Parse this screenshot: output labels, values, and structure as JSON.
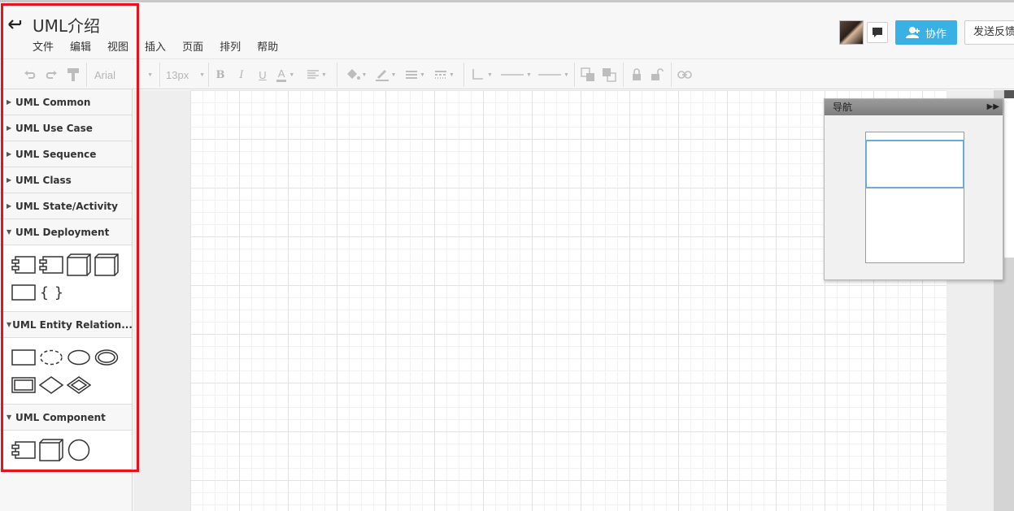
{
  "header": {
    "title": "UML介绍",
    "menu": [
      "文件",
      "编辑",
      "视图",
      "插入",
      "页面",
      "排列",
      "帮助"
    ],
    "collab_label": "协作",
    "feedback_label": "发送反馈"
  },
  "toolbar": {
    "font_family": "Arial",
    "font_size": "13px",
    "bold": "B",
    "italic": "I",
    "underline": "U",
    "font_color": "A"
  },
  "sidebar": {
    "categories": [
      {
        "label": "UML Common",
        "expanded": false
      },
      {
        "label": "UML Use Case",
        "expanded": false
      },
      {
        "label": "UML Sequence",
        "expanded": false
      },
      {
        "label": "UML Class",
        "expanded": false
      },
      {
        "label": "UML State/Activity",
        "expanded": false
      },
      {
        "label": "UML Deployment",
        "expanded": true,
        "shapes": [
          "component",
          "component",
          "node",
          "node",
          "rectangle",
          "braces"
        ]
      },
      {
        "label": "UML Entity Relation...",
        "expanded": true,
        "shapes": [
          "entity",
          "weak-attribute-dashed",
          "attribute-ellipse",
          "multivalued-attribute",
          "weak-entity",
          "relationship-diamond",
          "identifying-relationship"
        ]
      },
      {
        "label": "UML Component",
        "expanded": true,
        "shapes": [
          "component",
          "node",
          "interface-circle"
        ]
      }
    ]
  },
  "navigator": {
    "title": "导航"
  },
  "colors": {
    "accent": "#3ab1e4",
    "highlight": "#e8121b",
    "viewport": "#6aa9d8"
  }
}
